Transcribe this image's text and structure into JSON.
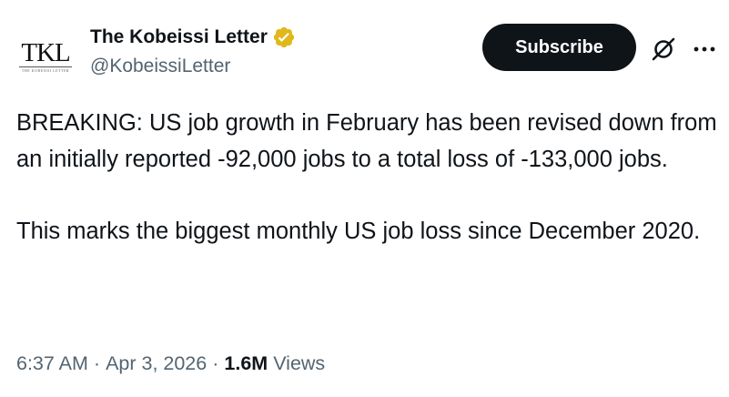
{
  "author": {
    "avatar_logo_text": "TKL",
    "avatar_tagline": "THE KOBEISSI LETTER",
    "display_name": "The Kobeissi Letter",
    "handle": "@KobeissiLetter",
    "verified_badge": "gold-verified-icon"
  },
  "actions": {
    "subscribe_label": "Subscribe",
    "grok_icon": "grok-icon",
    "more_icon": "more-icon"
  },
  "tweet": {
    "paragraphs": [
      "BREAKING: US job growth in February has been revised down from an initially reported -92,000 jobs to a total loss of -133,000 jobs.",
      "This marks the biggest monthly US job loss since December 2020."
    ]
  },
  "meta": {
    "time": "6:37 AM",
    "separator": "·",
    "date": "Apr 3, 2026",
    "views_count": "1.6M",
    "views_label": "Views"
  },
  "colors": {
    "text_primary": "#0f1419",
    "text_secondary": "#536471",
    "button_bg": "#0f1419",
    "verified_gold": "#e2b719"
  }
}
